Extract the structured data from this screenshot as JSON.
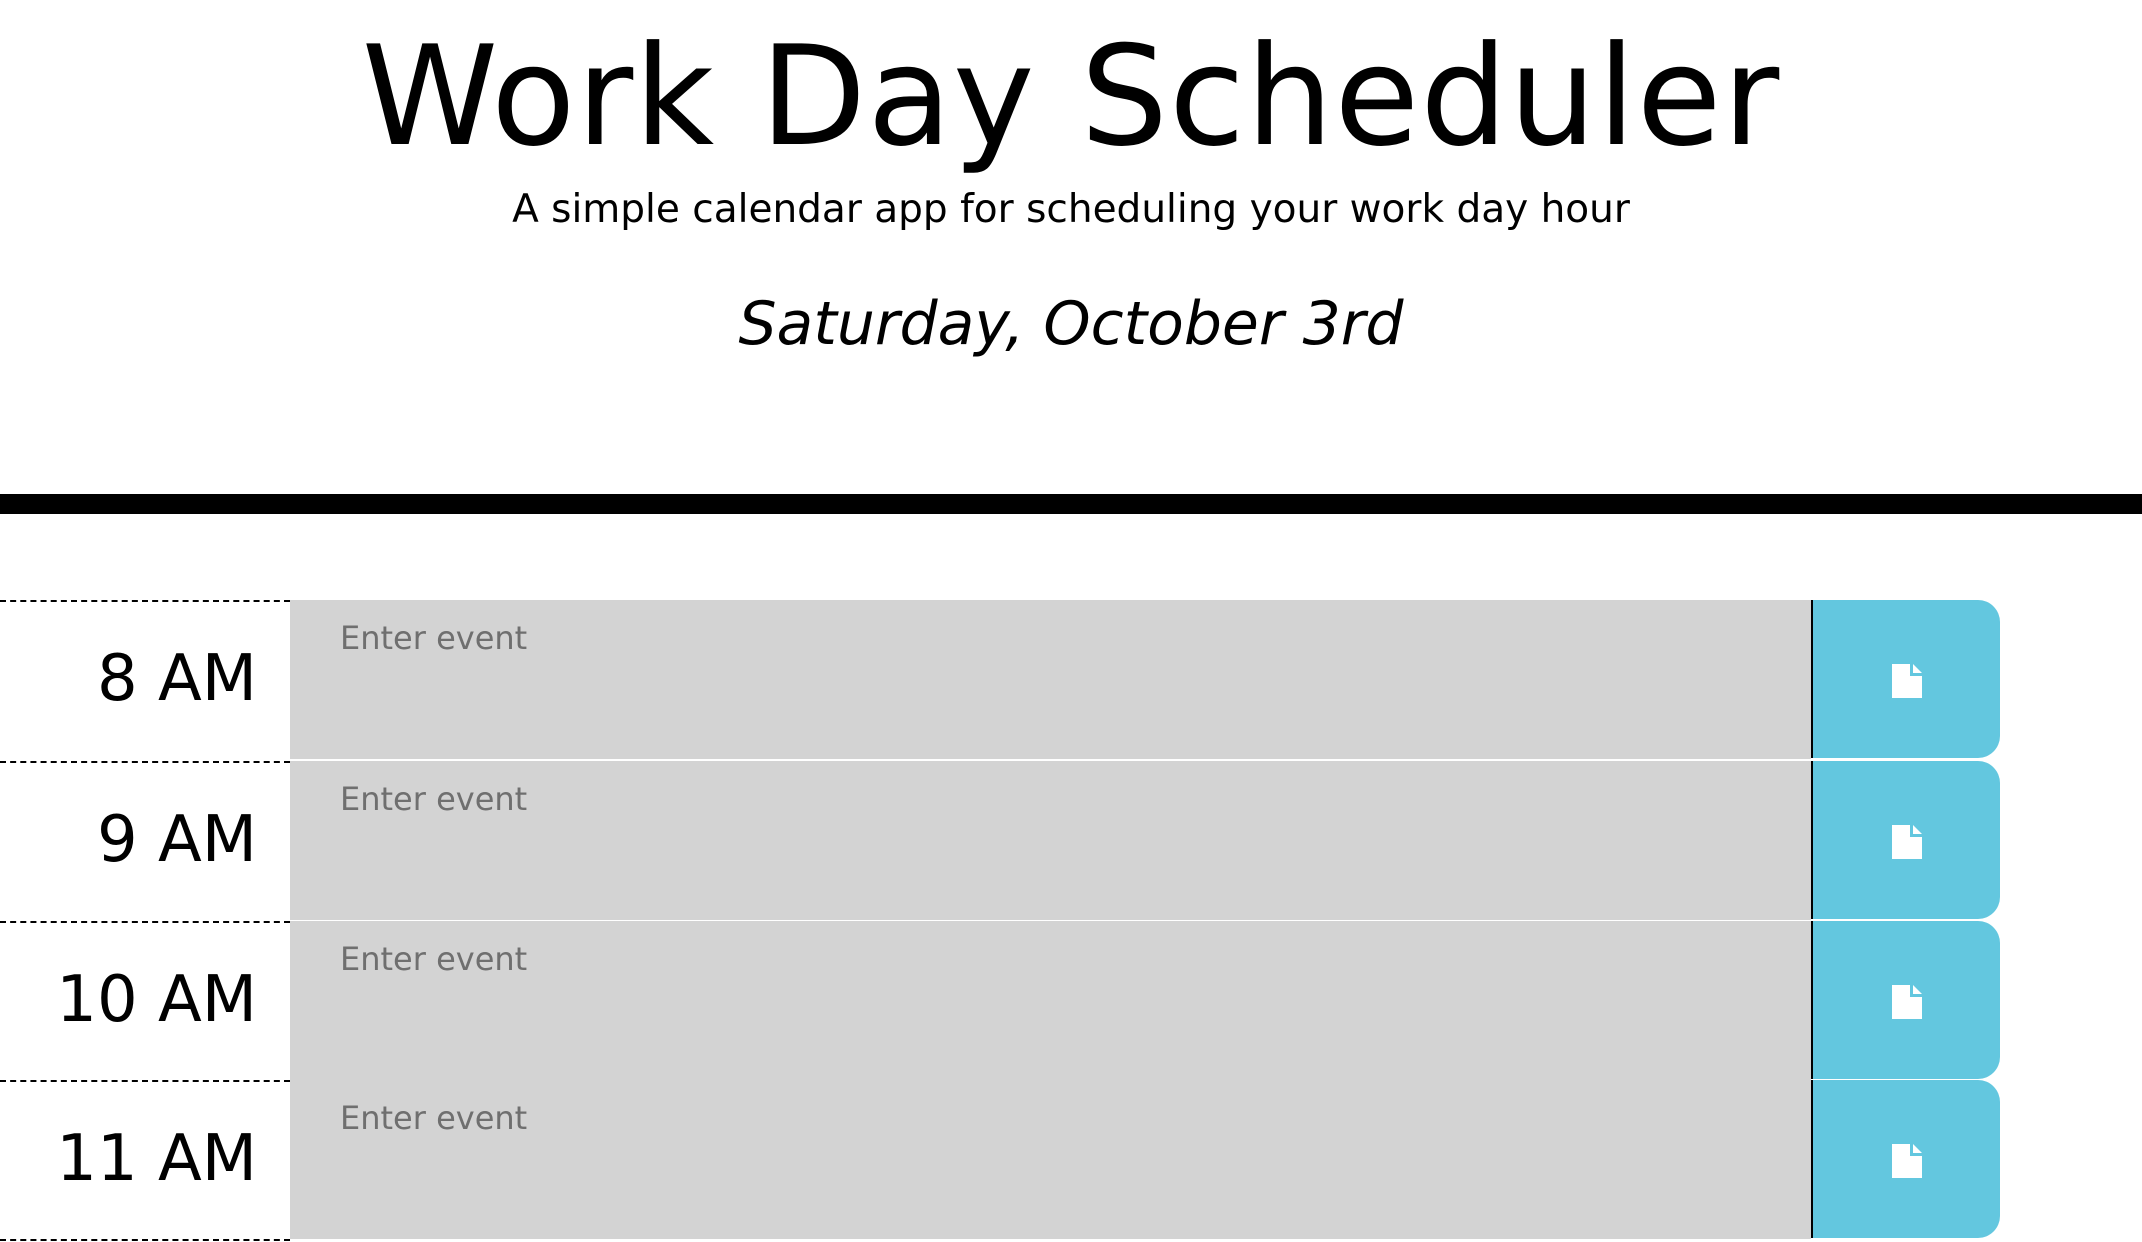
{
  "header": {
    "title": "Work Day Scheduler",
    "subtitle": "A simple calendar app for scheduling your work day hour",
    "current_day": "Saturday, October 3rd"
  },
  "time_blocks": [
    {
      "hour": "8 AM",
      "placeholder": "Enter event",
      "value": "",
      "status": "past"
    },
    {
      "hour": "9 AM",
      "placeholder": "Enter event",
      "value": "",
      "status": "past"
    },
    {
      "hour": "10 AM",
      "placeholder": "Enter event",
      "value": "",
      "status": "past"
    },
    {
      "hour": "11 AM",
      "placeholder": "Enter event",
      "value": "",
      "status": "past"
    }
  ],
  "save_button": {
    "icon": "save-icon"
  },
  "colors": {
    "past": "#d3d3d3",
    "save_button": "#63c7df",
    "header_border": "#000000"
  }
}
